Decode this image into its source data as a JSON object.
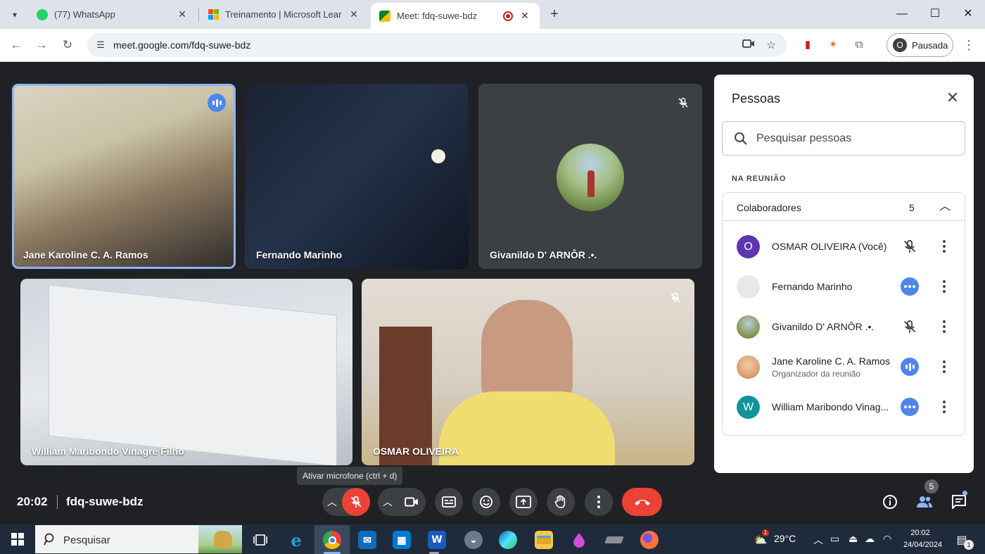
{
  "browser": {
    "tabs": [
      {
        "title": "(77) WhatsApp",
        "active": false
      },
      {
        "title": "Treinamento | Microsoft Learn",
        "active": false
      },
      {
        "title": "Meet: fdq-suwe-bdz",
        "active": true
      }
    ],
    "url": "meet.google.com/fdq-suwe-bdz",
    "profile_label": "Pausada",
    "profile_initial": "O"
  },
  "tiles": [
    {
      "name": "Jane Karoline C. A. Ramos",
      "status": "speaking"
    },
    {
      "name": "Fernando Marinho",
      "status": "none"
    },
    {
      "name": "Givanildo D' ARNÔR .•.",
      "status": "muted"
    },
    {
      "name": "William Maribondo Vinagre Filho",
      "status": "none"
    },
    {
      "name": "OSMAR OLIVEIRA",
      "status": "muted"
    }
  ],
  "people_panel": {
    "title": "Pessoas",
    "search_placeholder": "Pesquisar pessoas",
    "section_label": "NA REUNIÃO",
    "group_label": "Colaboradores",
    "group_count": "5",
    "participants": [
      {
        "name": "OSMAR OLIVEIRA (Você)",
        "role": "",
        "initial": "O",
        "avatar_color": "#5e35b1",
        "status": "muted"
      },
      {
        "name": "Fernando Marinho",
        "role": "",
        "initial": "",
        "avatar_color": "#e8e8e8",
        "status": "more"
      },
      {
        "name": "Givanildo D' ARNÔR .•.",
        "role": "",
        "initial": "",
        "avatar_color": "#8d9a5b",
        "status": "muted"
      },
      {
        "name": "Jane Karoline C. A. Ramos",
        "role": "Organizador da reunião",
        "initial": "",
        "avatar_color": "#e0a77a",
        "status": "speaking"
      },
      {
        "name": "William Maribondo Vinag...",
        "role": "",
        "initial": "W",
        "avatar_color": "#12939a",
        "status": "more"
      }
    ]
  },
  "tooltip": "Ativar microfone (ctrl + d)",
  "controls": {
    "time": "20:02",
    "meeting_code": "fdq-suwe-bdz",
    "people_badge": "5"
  },
  "taskbar": {
    "search_placeholder": "Pesquisar",
    "weather": "29°C",
    "weather_badge": "1",
    "time": "20:02",
    "date": "24/04/2024",
    "notification_count": "1"
  },
  "colors": {
    "meet_bg": "#202124",
    "hangup": "#ea4335",
    "active_speaker": "#8ab4f8",
    "accent_blue": "#4f86ec"
  }
}
